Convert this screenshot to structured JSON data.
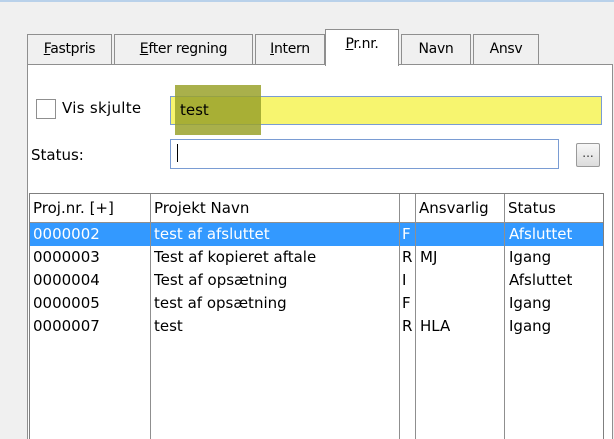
{
  "tabs": [
    {
      "label": "Fastpris"
    },
    {
      "label": "Efter regning"
    },
    {
      "label": "Intern"
    },
    {
      "label": "Pr.nr."
    },
    {
      "label": "Navn"
    },
    {
      "label": "Ansv"
    }
  ],
  "filter": {
    "show_hidden_label": "Vis skjulte",
    "show_hidden_checked": false,
    "search_value": "test",
    "status_label": "Status:",
    "status_value": "",
    "browse_button_label": "..."
  },
  "grid": {
    "columns": [
      "Proj.nr. [+]",
      "Projekt Navn",
      "",
      "Ansvarlig",
      "Status"
    ],
    "rows": [
      {
        "projnr": "0000002",
        "name": "test af afsluttet",
        "flag": "F",
        "owner": "",
        "status": "Afsluttet",
        "selected": true
      },
      {
        "projnr": "0000003",
        "name": "Test af kopieret aftale",
        "flag": "R",
        "owner": "MJ",
        "status": "Igang",
        "selected": false
      },
      {
        "projnr": "0000004",
        "name": "Test af opsætning",
        "flag": "I",
        "owner": "",
        "status": "Afsluttet",
        "selected": false
      },
      {
        "projnr": "0000005",
        "name": "test af opsætning",
        "flag": "F",
        "owner": "",
        "status": "Igang",
        "selected": false
      },
      {
        "projnr": "0000007",
        "name": "test",
        "flag": "R",
        "owner": "HLA",
        "status": "Igang",
        "selected": false
      }
    ]
  },
  "colors": {
    "selection": "#3399ff",
    "search_bg": "#f7f56f",
    "search_highlight": "#9aa22b"
  }
}
